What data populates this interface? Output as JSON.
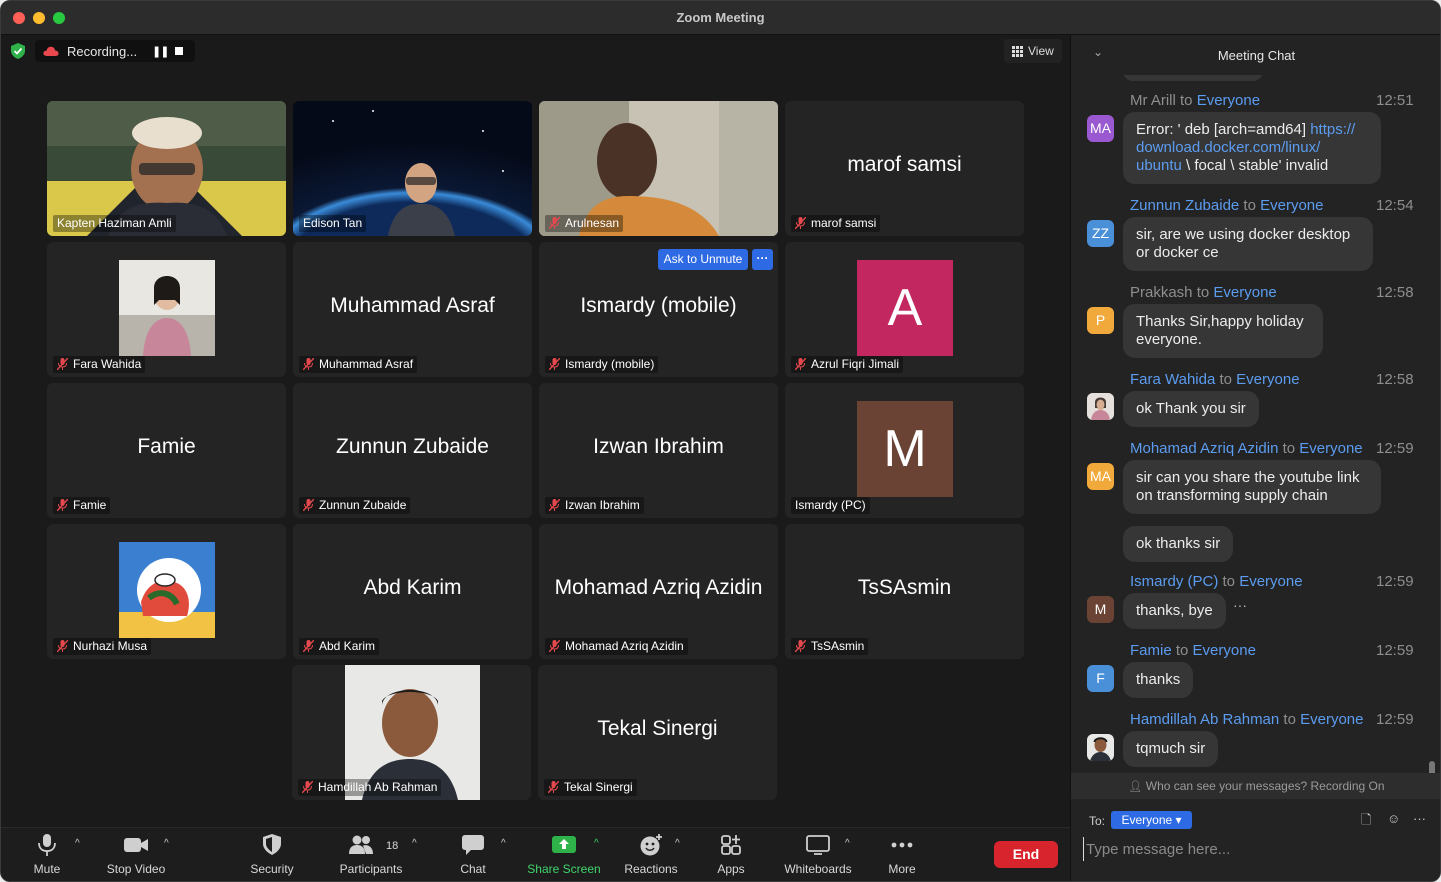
{
  "window": {
    "title": "Zoom Meeting"
  },
  "recording": {
    "label": "Recording..."
  },
  "view": {
    "label": "View"
  },
  "participants": [
    {
      "name": "Kapten Haziman Amli",
      "type": "video",
      "active": true
    },
    {
      "name": "Edison Tan",
      "type": "video"
    },
    {
      "name": "Arulnesan",
      "type": "video",
      "muted": true
    },
    {
      "name": "marof samsi",
      "type": "name",
      "display": "marof samsi",
      "muted": true
    },
    {
      "name": "Fara Wahida",
      "type": "photo",
      "muted": true
    },
    {
      "name": "Muhammad Asraf",
      "type": "name",
      "display": "Muhammad Asraf",
      "muted": true
    },
    {
      "name": "Ismardy (mobile)",
      "type": "name",
      "display": "Ismardy (mobile)",
      "muted": true,
      "ask_unmute": "Ask to Unmute"
    },
    {
      "name": "Azrul Fiqri Jimali",
      "type": "letter",
      "letter": "A",
      "color": "#c2275f",
      "muted": true
    },
    {
      "name": "Famie",
      "type": "name",
      "display": "Famie",
      "muted": true
    },
    {
      "name": "Zunnun Zubaide",
      "type": "name",
      "display": "Zunnun Zubaide",
      "muted": true
    },
    {
      "name": "Izwan Ibrahim",
      "type": "name",
      "display": "Izwan Ibrahim",
      "muted": true
    },
    {
      "name": "Ismardy (PC)",
      "type": "letter",
      "letter": "M",
      "color": "#6a4335",
      "muted": false
    },
    {
      "name": "Nurhazi Musa",
      "type": "photo",
      "muted": true
    },
    {
      "name": "Abd Karim",
      "type": "name",
      "display": "Abd Karim",
      "muted": true
    },
    {
      "name": "Mohamad Azriq Azidin",
      "type": "name",
      "display": "Mohamad Azriq Azidin",
      "muted": true
    },
    {
      "name": "TsSAsmin",
      "type": "name",
      "display": "TsSAsmin",
      "muted": true
    },
    {
      "name": "Hamdillah Ab Rahman",
      "type": "photo",
      "muted": true
    },
    {
      "name": "Tekal Sinergi",
      "type": "name",
      "display": "Tekal Sinergi",
      "muted": true
    }
  ],
  "toolbar": {
    "mute": "Mute",
    "stop_video": "Stop Video",
    "security": "Security",
    "participants": "Participants",
    "participant_count": "18",
    "chat": "Chat",
    "share_screen": "Share Screen",
    "reactions": "Reactions",
    "apps": "Apps",
    "whiteboards": "Whiteboards",
    "more": "More",
    "end": "End"
  },
  "chat": {
    "title": "Meeting Chat",
    "to_word": "to",
    "recipient": "Everyone",
    "messages": [
      {
        "sender": "Mr Arill",
        "initials": "MA",
        "avatar_color": "#9a59d1",
        "time": "12:51",
        "text_before": "Error: ' deb [arch=amd64] ",
        "link": "https://download.docker.com/linux/ubuntu",
        "link_l1": "https://",
        "link_l2": "download.docker.com/linux/",
        "link_l3": "ubuntu",
        "text_after": " \\ focal \\ stable' invalid"
      },
      {
        "sender": "Zunnun Zubaide",
        "initials": "ZZ",
        "avatar_color": "#4a90d9",
        "time": "12:54",
        "text": "sir, are we using docker desktop or docker ce"
      },
      {
        "sender": "Prakkash",
        "initials": "P",
        "avatar_color": "#f2a93b",
        "time": "12:58",
        "text": "Thanks Sir,happy holiday everyone."
      },
      {
        "sender": "Fara Wahida",
        "initials": "",
        "avatar_color": "#d8c8c8",
        "time": "12:58",
        "text": "ok Thank you sir"
      },
      {
        "sender": "Mohamad Azriq Azidin",
        "initials": "MA",
        "avatar_color": "#f2a93b",
        "time": "12:59",
        "text": "sir can you share the youtube link on transforming supply chain",
        "text2": "ok thanks sir"
      },
      {
        "sender": "Ismardy (PC)",
        "initials": "M",
        "avatar_color": "#6a4335",
        "time": "12:59",
        "text": "thanks, bye"
      },
      {
        "sender": "Famie",
        "initials": "F",
        "avatar_color": "#4a90d9",
        "time": "12:59",
        "text": "thanks"
      },
      {
        "sender": "Hamdillah Ab Rahman",
        "initials": "",
        "avatar_color": "#c9b7a8",
        "time": "12:59",
        "text": "tqmuch sir"
      }
    ],
    "privacy_note": "Who can see your messages? Recording On",
    "to_label": "To:",
    "to_value": "Everyone",
    "input_placeholder": "Type message here..."
  }
}
